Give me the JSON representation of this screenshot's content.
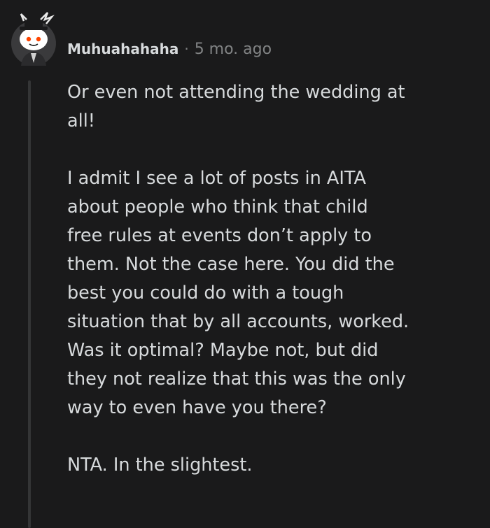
{
  "comment": {
    "author": "Muhuahahaha",
    "separator": "·",
    "timestamp": "5 mo. ago",
    "avatar_icon": "snoo-avatar-icon",
    "paragraphs": [
      "Or even not attending the wedding at\nall!",
      "I admit I see a lot of posts in AITA\nabout people who think that child\nfree rules at events don’t apply to\nthem. Not the case here. You did the\nbest you could do with a tough\nsituation that by all accounts, worked.\nWas it optimal? Maybe not, but did\nthey not realize that this was the only\nway to even have you there?",
      "NTA. In the slightest."
    ]
  },
  "colors": {
    "background": "#1a1a1b",
    "text": "#d7dadc",
    "muted": "#818384",
    "thread_line": "#343536"
  }
}
